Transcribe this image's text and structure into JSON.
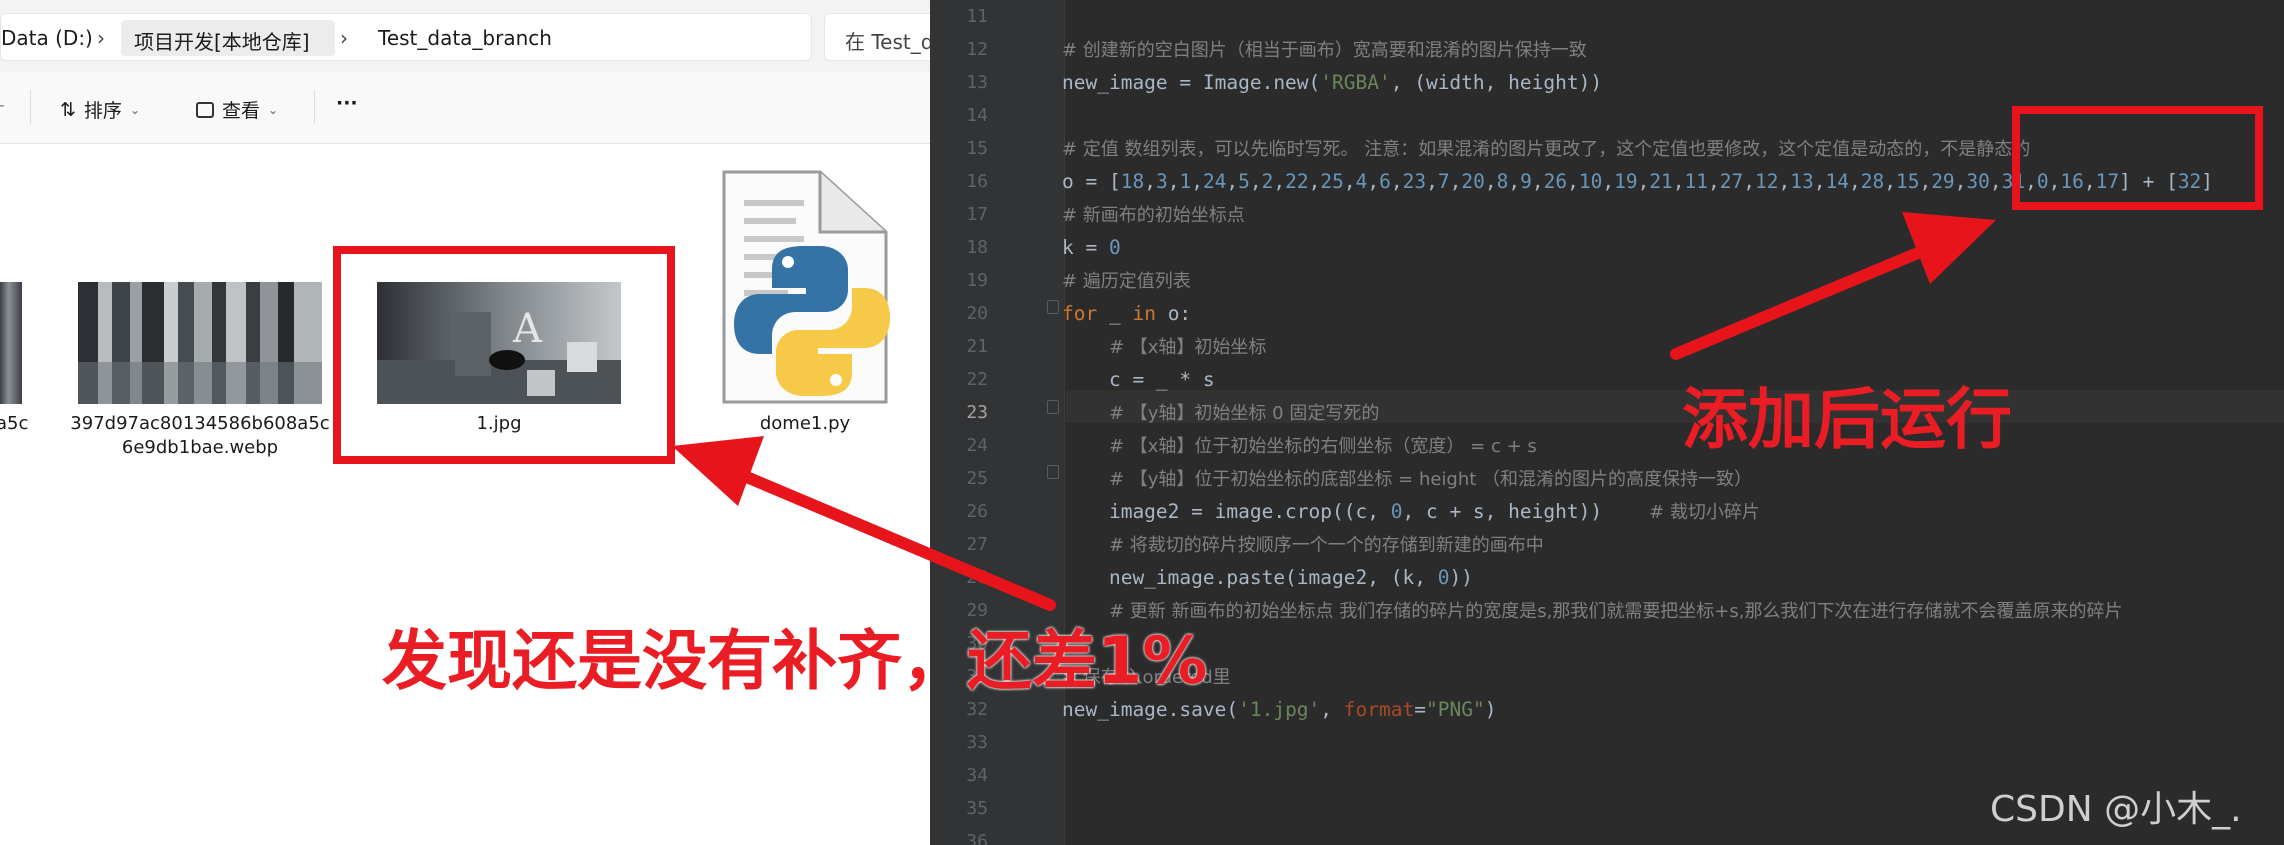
{
  "explorer": {
    "breadcrumb": [
      {
        "label": "Data (D:)"
      },
      {
        "label": "项目开发[本地仓库]"
      },
      {
        "label": "Test_data_branch"
      }
    ],
    "search_placeholder": "在 Test_d",
    "toolbar": {
      "sort_label": "排序",
      "view_label": "查看",
      "more_label": "···"
    },
    "files": [
      {
        "name_line1": "a5c",
        "name_line2": ""
      },
      {
        "name_line1": "397d97ac80134586b608a5c",
        "name_line2": "6e9db1bae.webp"
      },
      {
        "name_line1": "1.jpg",
        "name_line2": ""
      },
      {
        "name_line1": "dome1.py",
        "name_line2": ""
      }
    ]
  },
  "editor": {
    "lines": [
      {
        "n": "11",
        "html": ""
      },
      {
        "n": "12",
        "html": "<span class='c'># 创建新的空白图片（相当于画布）宽高要和混淆的图片保持一致</span>"
      },
      {
        "n": "13",
        "html": "new_image = Image.new(<span class='s'>'RGBA'</span>, (width, height))"
      },
      {
        "n": "14",
        "html": ""
      },
      {
        "n": "15",
        "html": "<span class='c'># 定值 数组列表，可以先临时写死。 注意：如果混淆的图片更改了，这个定值也要修改，这个定值是动态的，不是静态的</span>"
      },
      {
        "n": "16",
        "html": "o = [<span class='n'>18</span>,<span class='n'>3</span>,<span class='n'>1</span>,<span class='n'>24</span>,<span class='n'>5</span>,<span class='n'>2</span>,<span class='n'>22</span>,<span class='n'>25</span>,<span class='n'>4</span>,<span class='n'>6</span>,<span class='n'>23</span>,<span class='n'>7</span>,<span class='n'>20</span>,<span class='n'>8</span>,<span class='n'>9</span>,<span class='n'>26</span>,<span class='n'>10</span>,<span class='n'>19</span>,<span class='n'>21</span>,<span class='n'>11</span>,<span class='n'>27</span>,<span class='n'>12</span>,<span class='n'>13</span>,<span class='n'>14</span>,<span class='n'>28</span>,<span class='n'>15</span>,<span class='n'>29</span>,<span class='n'>30</span>,<span class='n'>31</span>,<span class='n'>0</span>,<span class='n'>16</span>,<span class='n'>17</span>] + [<span class='n'>32</span>]"
      },
      {
        "n": "17",
        "html": "<span class='c'># 新画布的初始坐标点</span>"
      },
      {
        "n": "18",
        "html": "k = <span class='n'>0</span>"
      },
      {
        "n": "19",
        "html": "<span class='c'># 遍历定值列表</span>"
      },
      {
        "n": "20",
        "html": "<span class='k'>for</span> _ <span class='k'>in</span> o:"
      },
      {
        "n": "21",
        "html": "    <span class='c'># 【x轴】初始坐标</span>"
      },
      {
        "n": "22",
        "html": "    c = _ * s"
      },
      {
        "n": "23",
        "html": "    <span class='c'># 【y轴】初始坐标 0 固定写死的</span>"
      },
      {
        "n": "24",
        "html": "    <span class='c'># 【x轴】位于初始坐标的右侧坐标（宽度） = c + s</span>"
      },
      {
        "n": "25",
        "html": "    <span class='c'># 【y轴】位于初始坐标的底部坐标 = height （和混淆的图片的高度保持一致）</span>"
      },
      {
        "n": "26",
        "html": "    image2 = image.crop((c, <span class='n'>0</span>, c + s, height))    <span class='c'># 裁切小碎片</span>"
      },
      {
        "n": "27",
        "html": "    <span class='c'># 将裁切的碎片按顺序一个一个的存储到新建的画布中</span>"
      },
      {
        "n": "28",
        "html": "    new_image.paste(image2, (k, <span class='n'>0</span>))"
      },
      {
        "n": "29",
        "html": "    <span class='c'># 更新 新画布的初始坐标点 我们存储的碎片的宽度是s,那我们就需要把坐标+s,那么我们下次在进行存储就不会覆盖原来的碎片</span>"
      },
      {
        "n": "30",
        "html": ""
      },
      {
        "n": "31",
        "html": "<span class='c'># 保存 入ordered里</span>"
      },
      {
        "n": "32",
        "html": "new_image.save(<span class='s'>'1.jpg'</span>, <span class='p'>format</span>=<span class='s'>\"PNG\"</span>)"
      },
      {
        "n": "33",
        "html": ""
      },
      {
        "n": "34",
        "html": ""
      },
      {
        "n": "35",
        "html": ""
      },
      {
        "n": "36",
        "html": ""
      }
    ]
  },
  "annotations": {
    "left_note": "发现还是没有补齐，还差1%",
    "right_note": "添加后运行",
    "watermark": "CSDN @小木_."
  },
  "colors": {
    "annotation_red": "#e8141c",
    "ide_background": "#2b2b2b",
    "comment": "#808080",
    "string": "#6a8759",
    "number": "#6897bb",
    "keyword": "#cc7832",
    "param": "#aa4926"
  }
}
